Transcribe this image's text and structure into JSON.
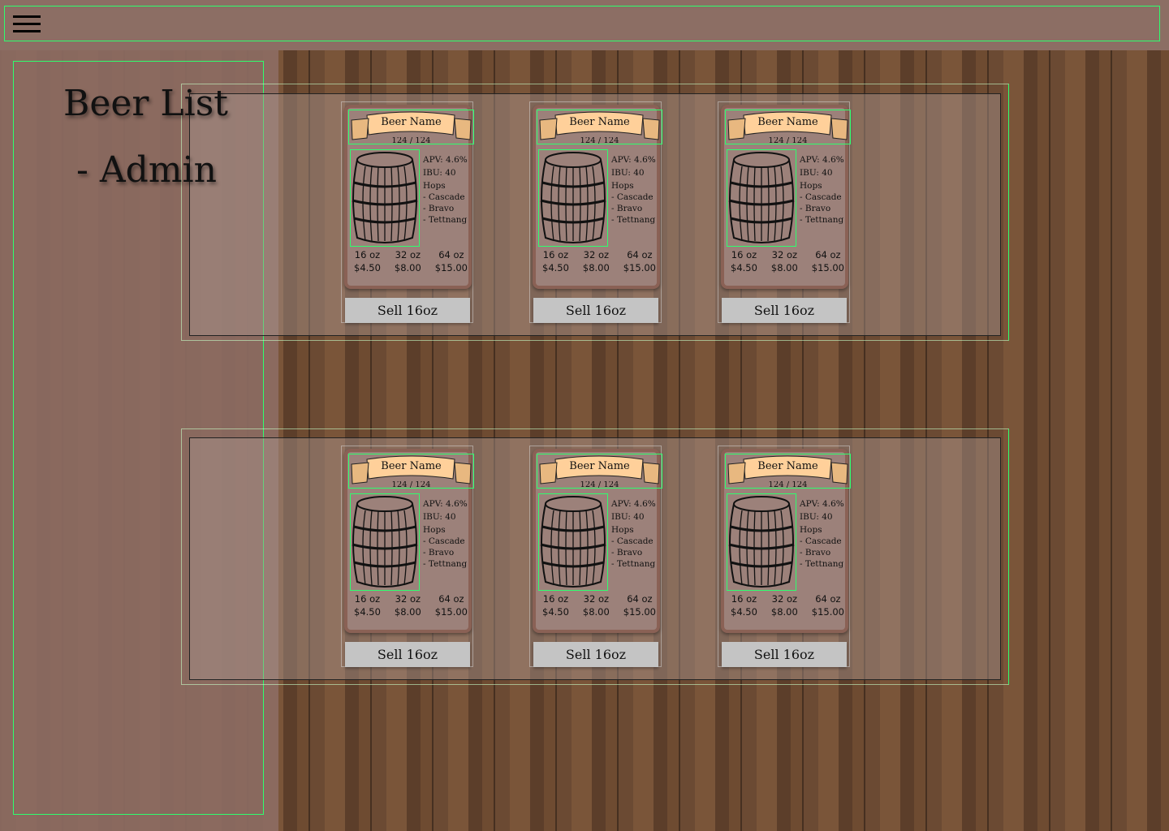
{
  "header": {
    "menu_icon": "hamburger-icon"
  },
  "sidebar": {
    "title_line1": "Beer List",
    "title_line2": "- Admin"
  },
  "colors": {
    "header": "#8c6e64",
    "card_border": "#8a6155",
    "card_fill": "#9c817a",
    "banner": "#ffd09a",
    "button": "#c4c4c4"
  },
  "cards": [
    {
      "name": "Beer Name",
      "count": "124 / 124",
      "abv": "APV: 4.6%",
      "ibu": "IBU: 40",
      "hops_label": "Hops",
      "hops": [
        "- Cascade",
        "- Bravo",
        "- Tettnang"
      ],
      "sizes": [
        "16 oz",
        "32 oz",
        "64 oz"
      ],
      "prices": [
        "$4.50",
        "$8.00",
        "$15.00"
      ],
      "button": "Sell 16oz"
    },
    {
      "name": "Beer Name",
      "count": "124 / 124",
      "abv": "APV: 4.6%",
      "ibu": "IBU: 40",
      "hops_label": "Hops",
      "hops": [
        "- Cascade",
        "- Bravo",
        "- Tettnang"
      ],
      "sizes": [
        "16 oz",
        "32 oz",
        "64 oz"
      ],
      "prices": [
        "$4.50",
        "$8.00",
        "$15.00"
      ],
      "button": "Sell 16oz"
    },
    {
      "name": "Beer Name",
      "count": "124 / 124",
      "abv": "APV: 4.6%",
      "ibu": "IBU: 40",
      "hops_label": "Hops",
      "hops": [
        "- Cascade",
        "- Bravo",
        "- Tettnang"
      ],
      "sizes": [
        "16 oz",
        "32 oz",
        "64 oz"
      ],
      "prices": [
        "$4.50",
        "$8.00",
        "$15.00"
      ],
      "button": "Sell 16oz"
    },
    {
      "name": "Beer Name",
      "count": "124 / 124",
      "abv": "APV: 4.6%",
      "ibu": "IBU: 40",
      "hops_label": "Hops",
      "hops": [
        "- Cascade",
        "- Bravo",
        "- Tettnang"
      ],
      "sizes": [
        "16 oz",
        "32 oz",
        "64 oz"
      ],
      "prices": [
        "$4.50",
        "$8.00",
        "$15.00"
      ],
      "button": "Sell 16oz"
    },
    {
      "name": "Beer Name",
      "count": "124 / 124",
      "abv": "APV: 4.6%",
      "ibu": "IBU: 40",
      "hops_label": "Hops",
      "hops": [
        "- Cascade",
        "- Bravo",
        "- Tettnang"
      ],
      "sizes": [
        "16 oz",
        "32 oz",
        "64 oz"
      ],
      "prices": [
        "$4.50",
        "$8.00",
        "$15.00"
      ],
      "button": "Sell 16oz"
    },
    {
      "name": "Beer Name",
      "count": "124 / 124",
      "abv": "APV: 4.6%",
      "ibu": "IBU: 40",
      "hops_label": "Hops",
      "hops": [
        "- Cascade",
        "- Bravo",
        "- Tettnang"
      ],
      "sizes": [
        "16 oz",
        "32 oz",
        "64 oz"
      ],
      "prices": [
        "$4.50",
        "$8.00",
        "$15.00"
      ],
      "button": "Sell 16oz"
    }
  ]
}
